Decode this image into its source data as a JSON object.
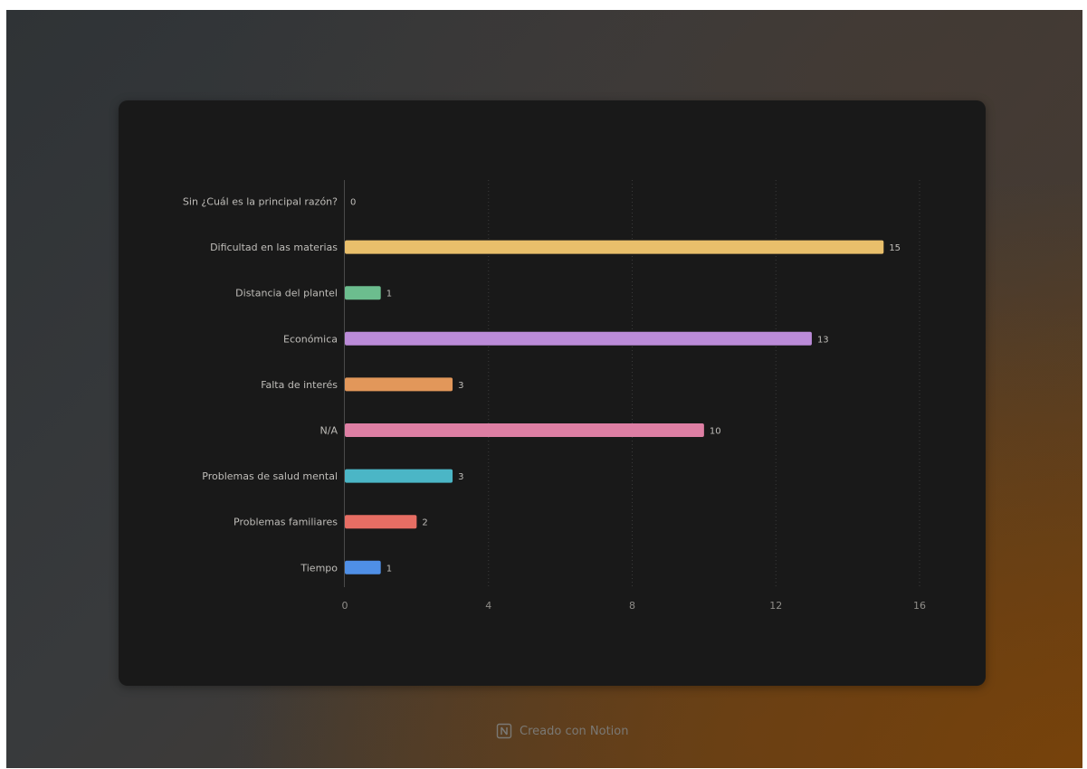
{
  "footer": {
    "text": "Creado con Notion",
    "logo_icon": "notion-logo-icon"
  },
  "chart_data": {
    "type": "bar",
    "orientation": "horizontal",
    "categories": [
      "Sin ¿Cuál es la principal razón?",
      "Dificultad en las materias",
      "Distancia del plantel",
      "Económica",
      "Falta de interés",
      "N/A",
      "Problemas de salud mental",
      "Problemas familiares",
      "Tiempo"
    ],
    "values": [
      0,
      15,
      1,
      13,
      3,
      10,
      3,
      2,
      1
    ],
    "colors": [
      "#888888",
      "#e9bf6b",
      "#6cbd8e",
      "#bb8bd8",
      "#e2975a",
      "#de7fa4",
      "#4bb6c6",
      "#e76e64",
      "#4f8fe6"
    ],
    "x_ticks": [
      0,
      4,
      8,
      12,
      16
    ],
    "xlim": [
      0,
      16
    ],
    "title": "",
    "xlabel": "",
    "ylabel": "",
    "grid": "vertical dotted",
    "legend": "none",
    "background": "#191919",
    "label_color": "#bfbdb9",
    "tick_color": "#8f8d89"
  }
}
